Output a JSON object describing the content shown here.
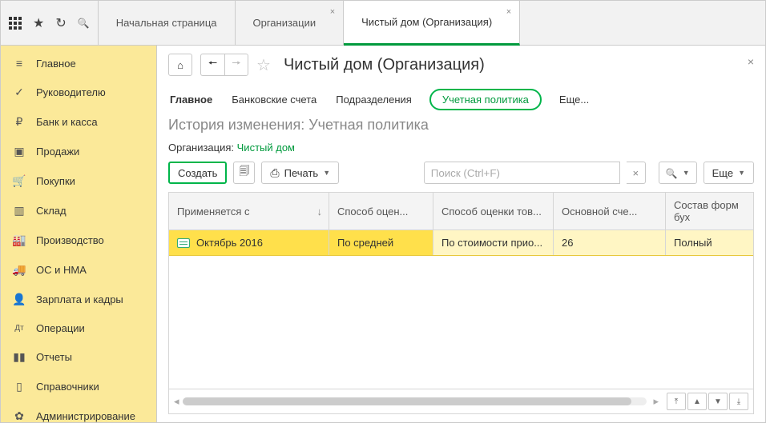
{
  "topbar": {
    "tabs": [
      {
        "label": "Начальная страница",
        "closable": false,
        "active": false
      },
      {
        "label": "Организации",
        "closable": true,
        "active": false
      },
      {
        "label": "Чистый дом (Организация)",
        "closable": true,
        "active": true
      }
    ]
  },
  "sidebar": {
    "items": [
      {
        "icon": "≡",
        "label": "Главное"
      },
      {
        "icon": "✓",
        "label": "Руководителю"
      },
      {
        "icon": "₽",
        "label": "Банк и касса"
      },
      {
        "icon": "▣",
        "label": "Продажи"
      },
      {
        "icon": "🛒",
        "label": "Покупки"
      },
      {
        "icon": "▥",
        "label": "Склад"
      },
      {
        "icon": "🏭",
        "label": "Производство"
      },
      {
        "icon": "🚚",
        "label": "ОС и НМА"
      },
      {
        "icon": "👤",
        "label": "Зарплата и кадры"
      },
      {
        "icon": "Дт",
        "label": "Операции"
      },
      {
        "icon": "▮▮",
        "label": "Отчеты"
      },
      {
        "icon": "▯",
        "label": "Справочники"
      },
      {
        "icon": "✿",
        "label": "Администрирование"
      }
    ]
  },
  "page": {
    "title": "Чистый дом (Организация)",
    "section_tabs": {
      "main": "Главное",
      "bank": "Банковские счета",
      "divisions": "Подразделения",
      "policy": "Учетная политика",
      "more": "Еще..."
    },
    "subtitle": "История изменения: Учетная политика",
    "org_label": "Организация: ",
    "org_value": "Чистый дом"
  },
  "toolbar": {
    "create": "Создать",
    "print": "Печать",
    "more": "Еще"
  },
  "search": {
    "placeholder": "Поиск (Ctrl+F)"
  },
  "table": {
    "columns": [
      "Применяется с",
      "Способ оцен...",
      "Способ оценки тов...",
      "Основной сче...",
      "Состав форм бух"
    ],
    "rows": [
      {
        "applies_from": "Октябрь 2016",
        "method1": "По средней",
        "method2": "По стоимости прио...",
        "account": "26",
        "forms": "Полный"
      }
    ]
  }
}
